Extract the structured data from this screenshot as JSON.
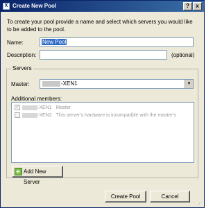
{
  "window": {
    "title": "Create New Pool",
    "help_glyph": "?",
    "close_glyph": "x"
  },
  "intro_text": "To create your pool provide a name and select which servers you would like to be added to the pool.",
  "name": {
    "label": "Name:",
    "value": "New Pool"
  },
  "description": {
    "label": "Description:",
    "value": "",
    "hint": "(optional)"
  },
  "servers_group": {
    "title": "Servers",
    "master_label": "Master:",
    "master_value": "-XEN1",
    "additional_label": "Additional members:",
    "members": [
      {
        "name": "-XEN1",
        "note": "Master",
        "checked": true
      },
      {
        "name": "-XEN2",
        "note": "This server's hardware is incompatible with the master's",
        "checked": false
      }
    ],
    "add_button": "Add New Server"
  },
  "buttons": {
    "create": "Create Pool",
    "cancel": "Cancel"
  },
  "colors": {
    "titlebar": "#0a246a",
    "selection": "#316ac5",
    "dialog_bg": "#ece9d8"
  }
}
